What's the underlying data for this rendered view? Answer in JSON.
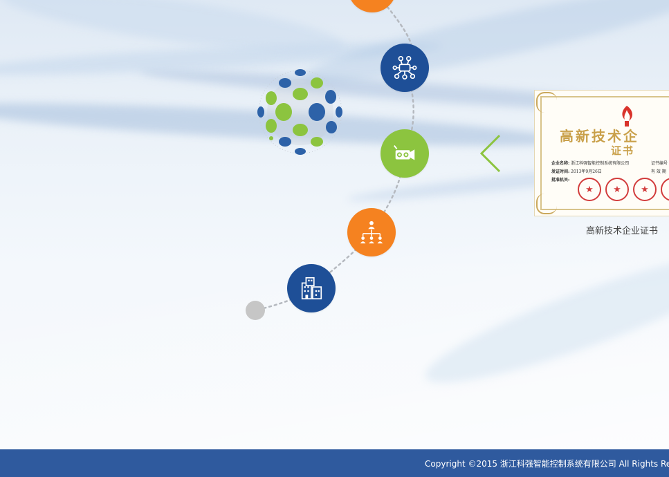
{
  "colors": {
    "orange": "#f58220",
    "navy": "#1e4f97",
    "green": "#8cc43f",
    "gray_dot": "#c6c6c6",
    "footer_bg": "#2f5a9e",
    "arrow": "#8cc43f"
  },
  "timeline": {
    "nodes": [
      {
        "color": "orange",
        "icon": "partial-orange-node"
      },
      {
        "color": "navy",
        "icon": "network-diagram-icon"
      },
      {
        "color": "green",
        "icon": "video-camera-icon"
      },
      {
        "color": "orange",
        "icon": "org-chart-icon"
      },
      {
        "color": "navy",
        "icon": "buildings-icon"
      },
      {
        "color": "gray_dot",
        "icon": "timeline-start-dot"
      }
    ]
  },
  "carousel": {
    "prev_icon": "chevron-left-icon",
    "certificate": {
      "title": "高新技术企",
      "subtitle": "证书",
      "company_label": "企业名称:",
      "company_value": "浙江科强智能控制系统有限公司",
      "issue_label": "发证时间:",
      "issue_value": "2013年9月26日",
      "authority_label": "批准机关:",
      "cert_no_label": "证书编号",
      "valid_label": "有 效 期",
      "stamp_glyph": "★"
    },
    "caption": "高新技术企业证书"
  },
  "footer": {
    "copyright": "Copyright ©2015 浙江科强智能控制系统有限公司 All Rights Re"
  }
}
